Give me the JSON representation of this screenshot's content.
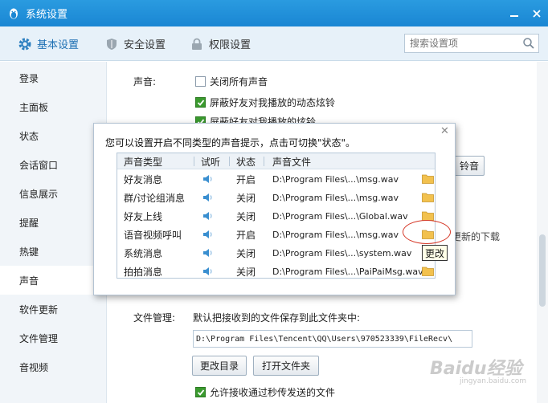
{
  "window": {
    "title": "系统设置"
  },
  "tabs": [
    {
      "label": "基本设置",
      "icon": "gear-icon"
    },
    {
      "label": "安全设置",
      "icon": "shield-icon"
    },
    {
      "label": "权限设置",
      "icon": "lock-icon"
    }
  ],
  "search": {
    "placeholder": "搜索设置项"
  },
  "sidebar": {
    "items": [
      {
        "label": "登录"
      },
      {
        "label": "主面板"
      },
      {
        "label": "状态"
      },
      {
        "label": "会话窗口"
      },
      {
        "label": "信息展示"
      },
      {
        "label": "提醒"
      },
      {
        "label": "热键"
      },
      {
        "label": "声音"
      },
      {
        "label": "软件更新"
      },
      {
        "label": "文件管理"
      },
      {
        "label": "音视频"
      }
    ],
    "active": "声音"
  },
  "sound": {
    "label": "声音:",
    "options": [
      {
        "label": "关闭所有声音",
        "checked": false
      },
      {
        "label": "屏蔽好友对我播放的动态炫铃",
        "checked": true
      },
      {
        "label": "屏蔽好友对我播放的炫铃",
        "checked": true
      }
    ],
    "ringtone_button_partial": "铃音",
    "update_partial": "更新的下载"
  },
  "file_mgmt": {
    "label": "文件管理:",
    "desc": "默认把接收到的文件保存到此文件夹中:",
    "path": "D:\\Program Files\\Tencent\\QQ\\Users\\970523339\\FileRecv\\",
    "change_dir_button": "更改目录",
    "open_folder_button": "打开文件夹",
    "allow_option": {
      "label": "允许接收通过秒传发送的文件",
      "checked": true
    }
  },
  "dialog": {
    "message": "您可以设置开启不同类型的声音提示，点击可切换\"状态\"。",
    "columns": [
      "声音类型",
      "试听",
      "状态",
      "声音文件"
    ],
    "rows": [
      {
        "type": "好友消息",
        "status": "开启",
        "file": "D:\\Program Files\\...\\msg.wav"
      },
      {
        "type": "群/讨论组消息",
        "status": "关闭",
        "file": "D:\\Program Files\\...\\msg.wav"
      },
      {
        "type": "好友上线",
        "status": "关闭",
        "file": "D:\\Program Files\\...\\Global.wav"
      },
      {
        "type": "语音视频呼叫",
        "status": "开启",
        "file": "D:\\Program Files\\...\\msg.wav"
      },
      {
        "type": "系统消息",
        "status": "关闭",
        "file": "D:\\Program Files\\...\\system.wav"
      },
      {
        "type": "拍拍消息",
        "status": "关闭",
        "file": "D:\\Program Files\\...\\PaiPaiMsg.wav"
      }
    ],
    "tooltip": "更改"
  },
  "watermark": {
    "text": "Baidu经验",
    "sub": "jingyan.baidu.com"
  },
  "colors": {
    "titlebar": "#1a86d3",
    "accent": "#1d6fb3",
    "check": "#3a9a2e",
    "highlight_circle": "#d63a2a"
  }
}
